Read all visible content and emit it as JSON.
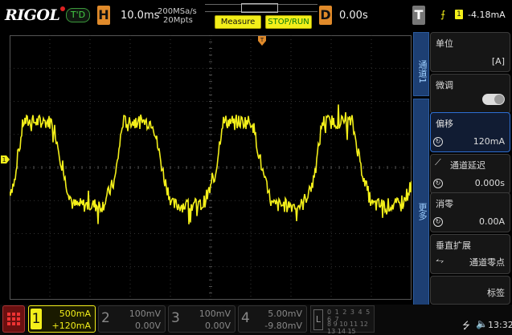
{
  "header": {
    "logo": "RIGOL",
    "run_status": "T'D",
    "horizontal_letter": "H",
    "timebase": "10.0ms",
    "sample_rate": "200MSa/s",
    "memory_depth": "20Mpts",
    "measure_label": "Measure",
    "stoprun_label": "STOP/RUN",
    "delay_letter": "D",
    "delay_value": "0.00s",
    "trigger_letter": "T",
    "trigger_source": "1",
    "trigger_level": "-4.18mA"
  },
  "side_menu": {
    "tab_top": "通道1",
    "tab_more": "更多",
    "items": [
      {
        "label": "单位",
        "value": "[A]"
      },
      {
        "label": "微调",
        "value": ""
      },
      {
        "label": "偏移",
        "value": "120mA"
      },
      {
        "label": "通道延迟",
        "value": "0.000s"
      },
      {
        "label": "消零",
        "value": "0.00A"
      },
      {
        "label": "垂直扩展",
        "value": "通道零点"
      },
      {
        "label": "",
        "value": "标签"
      }
    ]
  },
  "channels": [
    {
      "num": "1",
      "scale": "500mA",
      "offset": "+120mA",
      "color": "#f3ef1a"
    },
    {
      "num": "2",
      "scale": "100mV",
      "offset": "0.00V",
      "color": "#888888"
    },
    {
      "num": "3",
      "scale": "100mV",
      "offset": "0.00V",
      "color": "#888888"
    },
    {
      "num": "4",
      "scale": "5.00mV",
      "offset": "-9.80mV",
      "color": "#888888"
    }
  ],
  "logic": {
    "letter": "L",
    "row1": "0 1 2 3 4 5 6 7",
    "row2": "8 9 10 11 12 13 14 15"
  },
  "clock": "13:32",
  "colors": {
    "ch1": "#f3ef1a",
    "accent_orange": "#e08a2a",
    "menu_blue": "#2d6fd4"
  }
}
